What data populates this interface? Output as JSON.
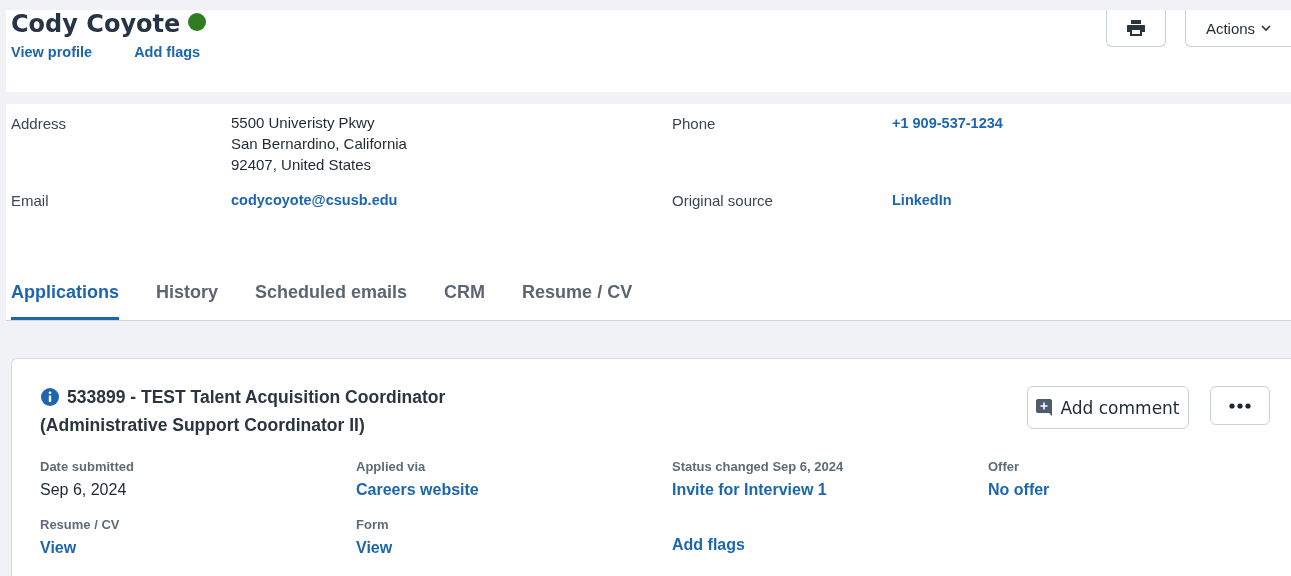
{
  "header": {
    "name": "Cody Coyote",
    "online": true,
    "links": [
      "View profile",
      "Add flags"
    ],
    "actions_button": "Actions"
  },
  "details": [
    {
      "label": "Address",
      "value_lines": [
        "5500 Univeristy Pkwy",
        "San Bernardino, California",
        "92407, United States"
      ],
      "kind": "text"
    },
    {
      "label": "Phone",
      "value_lines": [
        "+1 909-537-1234"
      ],
      "kind": "link"
    },
    {
      "label": "Email",
      "value_lines": [
        "codycoyote@csusb.edu"
      ],
      "kind": "link"
    },
    {
      "label": "Original source",
      "value_lines": [
        "LinkedIn"
      ],
      "kind": "link"
    }
  ],
  "tabs": [
    {
      "label": "Applications",
      "selected": true
    },
    {
      "label": "History",
      "selected": false
    },
    {
      "label": "Scheduled emails",
      "selected": false
    },
    {
      "label": "CRM",
      "selected": false
    },
    {
      "label": "Resume / CV",
      "selected": false
    }
  ],
  "application": {
    "title_lines": [
      "533899 - TEST Talent Acquisition Coordinator",
      "(Administrative Support Coordinator II)"
    ],
    "comment_button": "Add comment",
    "fields": [
      {
        "label": "Date submitted",
        "value": "Sep 6, 2024",
        "kind": "text"
      },
      {
        "label": "Applied via",
        "value": "Careers website",
        "kind": "link"
      },
      {
        "label": "Status changed Sep 6, 2024",
        "value": "Invite for Interview 1",
        "kind": "link"
      },
      {
        "label": "Offer",
        "value": "No offer",
        "kind": "link"
      },
      {
        "label": "Resume / CV",
        "value": "View",
        "kind": "link"
      },
      {
        "label": "Form",
        "value": "View",
        "kind": "link"
      },
      {
        "value": "Add flags",
        "kind": "link"
      }
    ]
  }
}
